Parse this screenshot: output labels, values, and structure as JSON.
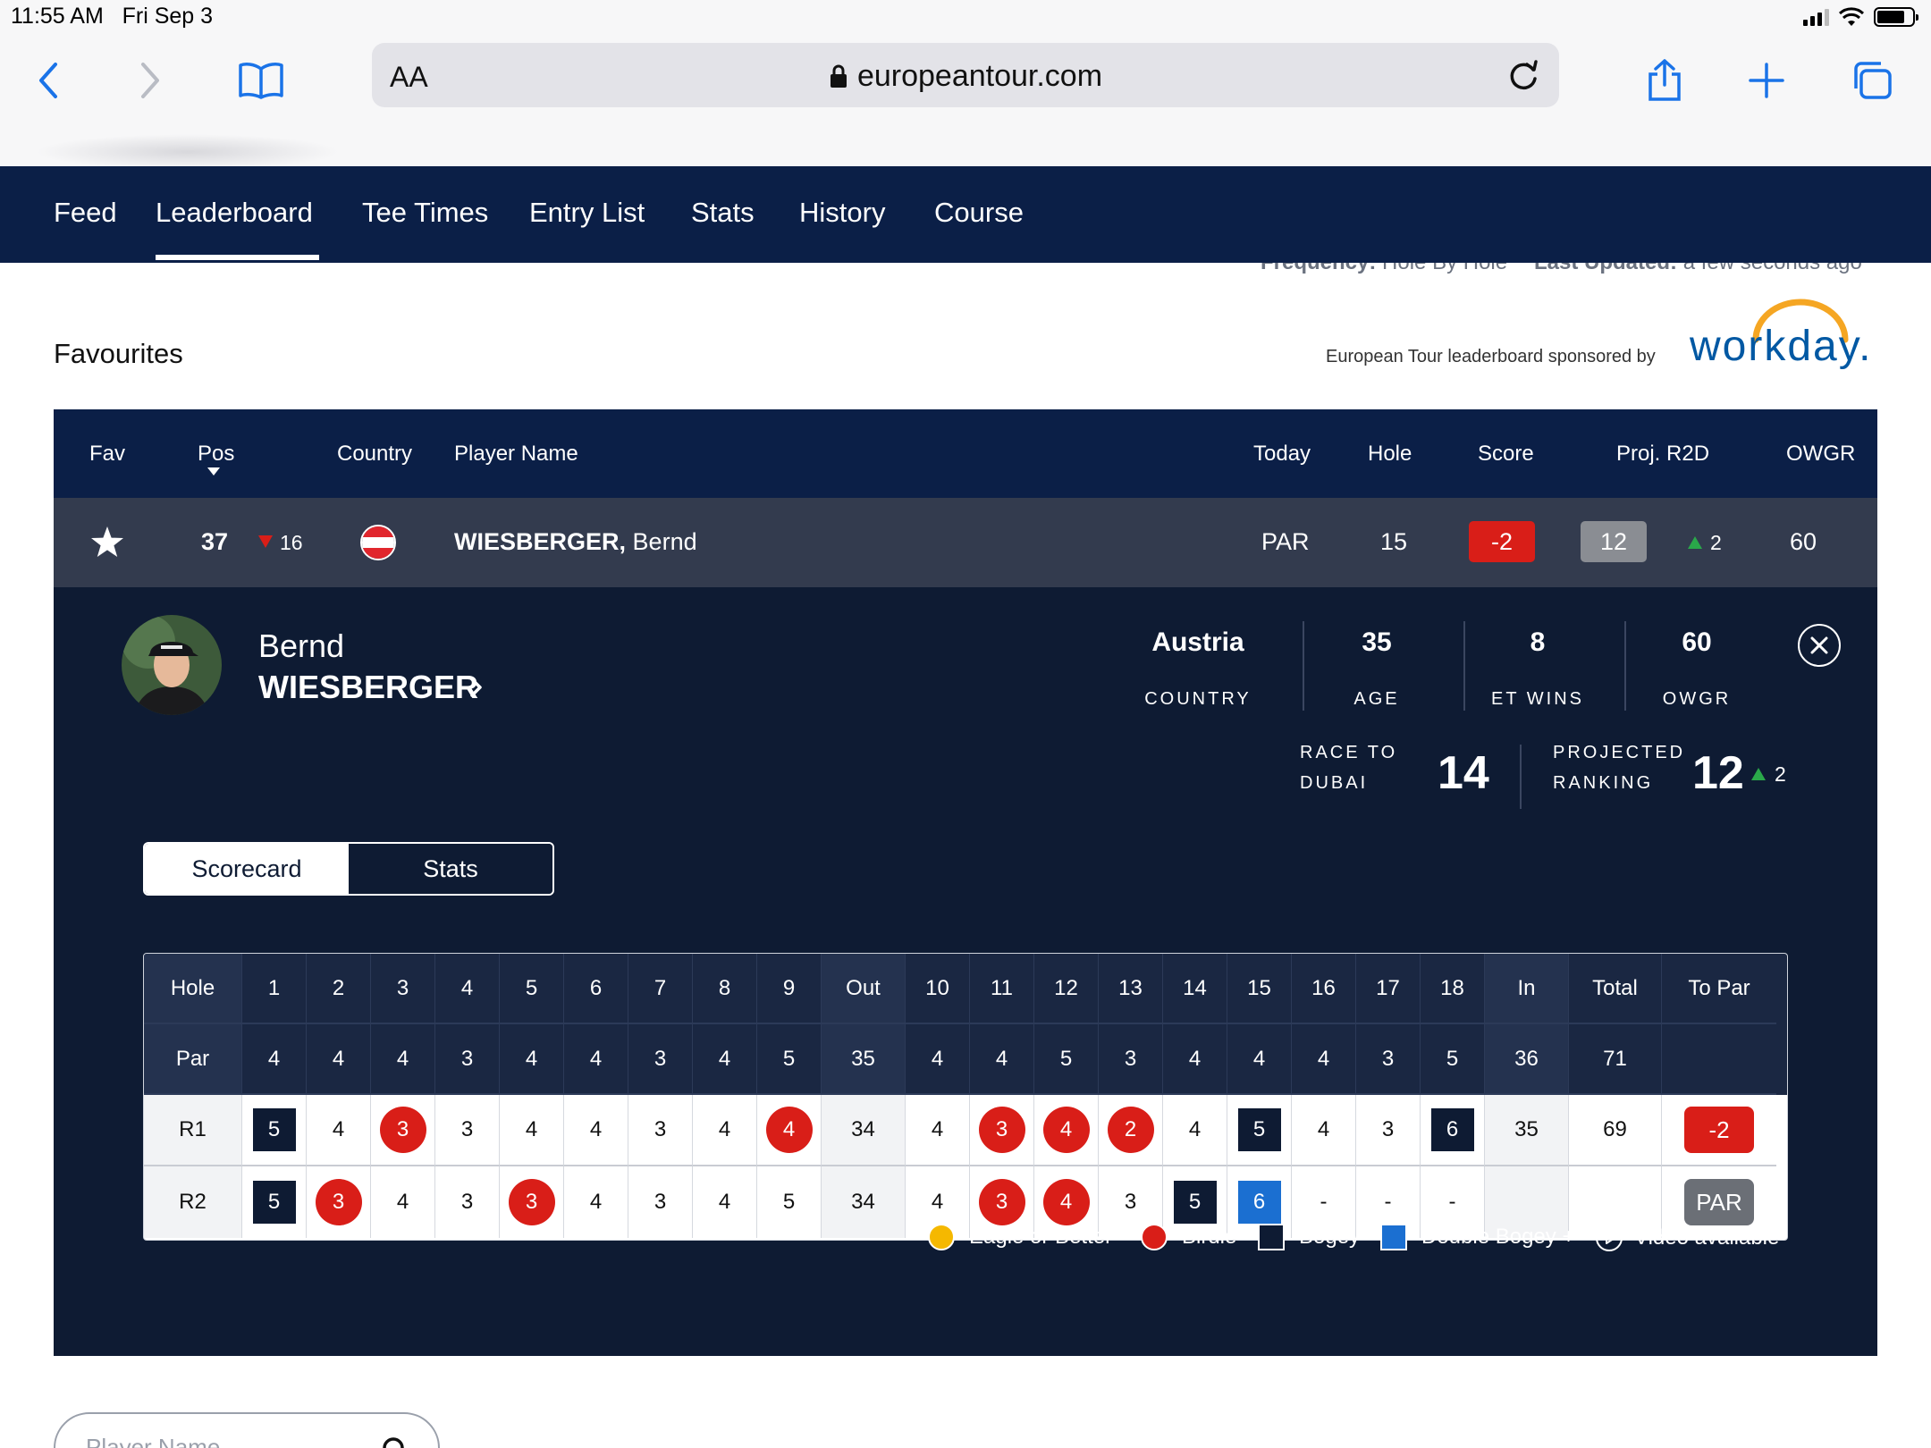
{
  "status_bar": {
    "time": "11:55 AM",
    "date": "Fri Sep 3"
  },
  "browser": {
    "text_size": "AA",
    "url": "europeantour.com"
  },
  "nav": {
    "tabs": [
      "Feed",
      "Leaderboard",
      "Tee Times",
      "Entry List",
      "Stats",
      "History",
      "Course"
    ],
    "active": "Leaderboard"
  },
  "info_line": {
    "frequency_label": "Frequency:",
    "frequency_value": "Hole By Hole",
    "updated_label": "Last Updated:",
    "updated_value": "a few seconds ago"
  },
  "section": {
    "title": "Favourites",
    "sponsor_text": "European Tour leaderboard sponsored by",
    "sponsor_logo": "workday."
  },
  "table": {
    "headers": {
      "fav": "Fav",
      "pos": "Pos",
      "country": "Country",
      "player": "Player Name",
      "today": "Today",
      "hole": "Hole",
      "score": "Score",
      "proj": "Proj. R2D",
      "owgr": "OWGR"
    },
    "row": {
      "pos": "37",
      "move": "16",
      "move_dir": "down",
      "surname": "WIESBERGER,",
      "firstname": "Bernd",
      "today": "PAR",
      "hole": "15",
      "score": "-2",
      "proj": "12",
      "proj_move": "2",
      "owgr": "60"
    }
  },
  "player": {
    "first": "Bernd",
    "last": "WIESBERGER",
    "country": "Austria",
    "country_label": "COUNTRY",
    "age": "35",
    "age_label": "AGE",
    "wins": "8",
    "wins_label": "ET WINS",
    "owgr": "60",
    "owgr_label": "OWGR",
    "race_label_1": "RACE TO",
    "race_label_2": "DUBAI",
    "race_value": "14",
    "proj_label_1": "PROJECTED",
    "proj_label_2": "RANKING",
    "proj_value": "12",
    "proj_move": "2"
  },
  "tabs": {
    "scorecard": "Scorecard",
    "stats": "Stats"
  },
  "scorecard": {
    "header": [
      "Hole",
      "1",
      "2",
      "3",
      "4",
      "5",
      "6",
      "7",
      "8",
      "9",
      "Out",
      "10",
      "11",
      "12",
      "13",
      "14",
      "15",
      "16",
      "17",
      "18",
      "In",
      "Total",
      "To Par"
    ],
    "par": [
      "Par",
      "4",
      "4",
      "4",
      "3",
      "4",
      "4",
      "3",
      "4",
      "5",
      "35",
      "4",
      "4",
      "5",
      "3",
      "4",
      "4",
      "4",
      "3",
      "5",
      "36",
      "71",
      ""
    ],
    "r1": [
      "R1",
      "5",
      "4",
      "3",
      "3",
      "4",
      "4",
      "3",
      "4",
      "4",
      "34",
      "4",
      "3",
      "4",
      "2",
      "4",
      "5",
      "4",
      "3",
      "6",
      "35",
      "69",
      "-2"
    ],
    "r2": [
      "R2",
      "5",
      "3",
      "4",
      "3",
      "3",
      "4",
      "3",
      "4",
      "5",
      "34",
      "4",
      "3",
      "4",
      "3",
      "5",
      "6",
      "-",
      "-",
      "-",
      "",
      "",
      "PAR"
    ],
    "r1_marks": [
      "",
      "bogey",
      "",
      "birdie",
      "",
      "",
      "",
      "",
      "",
      "birdie",
      "",
      "",
      "birdie",
      "birdie",
      "birdie",
      "",
      "bogey",
      "",
      "",
      "bogey",
      "",
      "",
      "topar-red"
    ],
    "r2_marks": [
      "",
      "bogey",
      "birdie",
      "",
      "",
      "birdie",
      "",
      "",
      "",
      "",
      "",
      "",
      "birdie",
      "birdie",
      "",
      "bogey",
      "double",
      "",
      "",
      "",
      "",
      "",
      "topar-grey"
    ]
  },
  "legend": {
    "eagle": "Eagle or Better",
    "birdie": "Birdie",
    "bogey": "Bogey",
    "double": "Double Bogey +",
    "video": "Video available"
  },
  "search": {
    "placeholder": "Player Name"
  },
  "colors": {
    "navy": "#0b1f47",
    "panel": "#0e1b33",
    "birdie_red": "#d91e18",
    "eagle_yellow": "#f5b800",
    "double_blue": "#1b6fd1",
    "up_green": "#2aa84a"
  }
}
